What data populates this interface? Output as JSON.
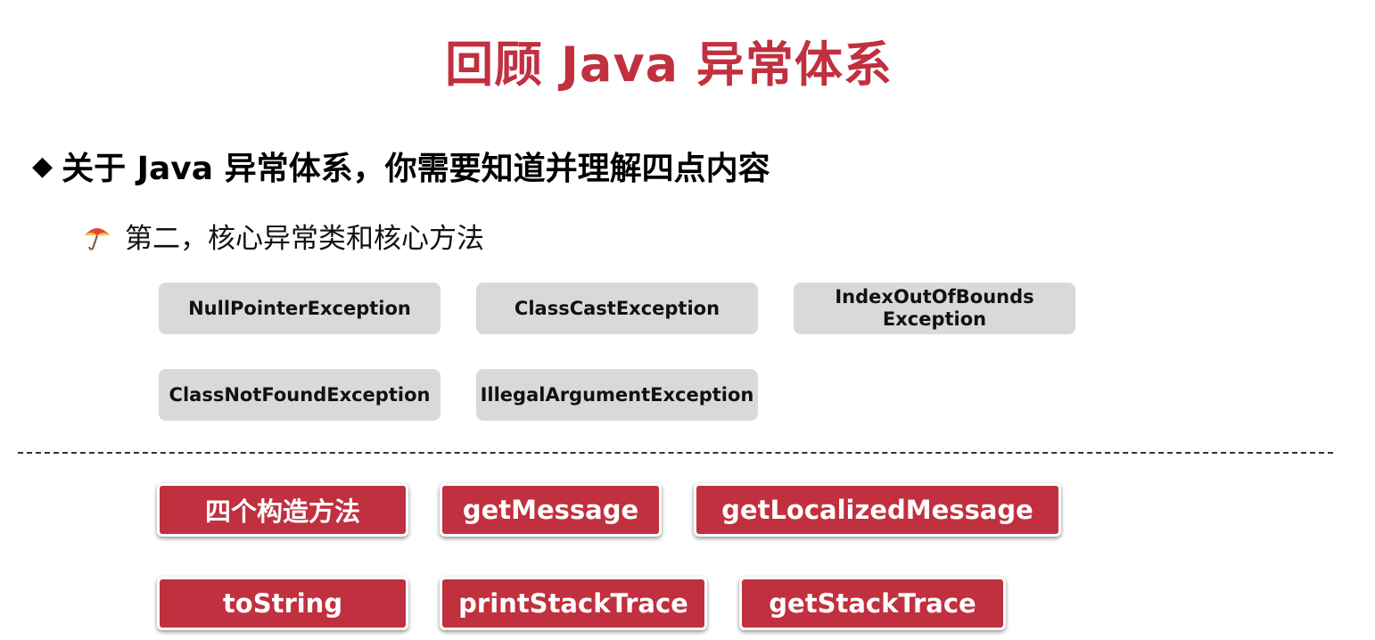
{
  "title": "回顾 Java 异常体系",
  "heading": {
    "bullet": "◆",
    "text": "关于 Java 异常体系，你需要知道并理解四点内容"
  },
  "subheading": {
    "text": "第二，核心异常类和核心方法"
  },
  "exceptions": [
    "NullPointerException",
    "ClassCastException",
    "IndexOutOfBounds\nException",
    "ClassNotFoundException",
    "IllegalArgumentException"
  ],
  "methods": [
    "四个构造方法",
    "getMessage",
    "getLocalizedMessage",
    "toString",
    "printStackTrace",
    "getStackTrace"
  ],
  "colors": {
    "accent": "#c0303f",
    "box_gray": "#d9d9d9"
  }
}
